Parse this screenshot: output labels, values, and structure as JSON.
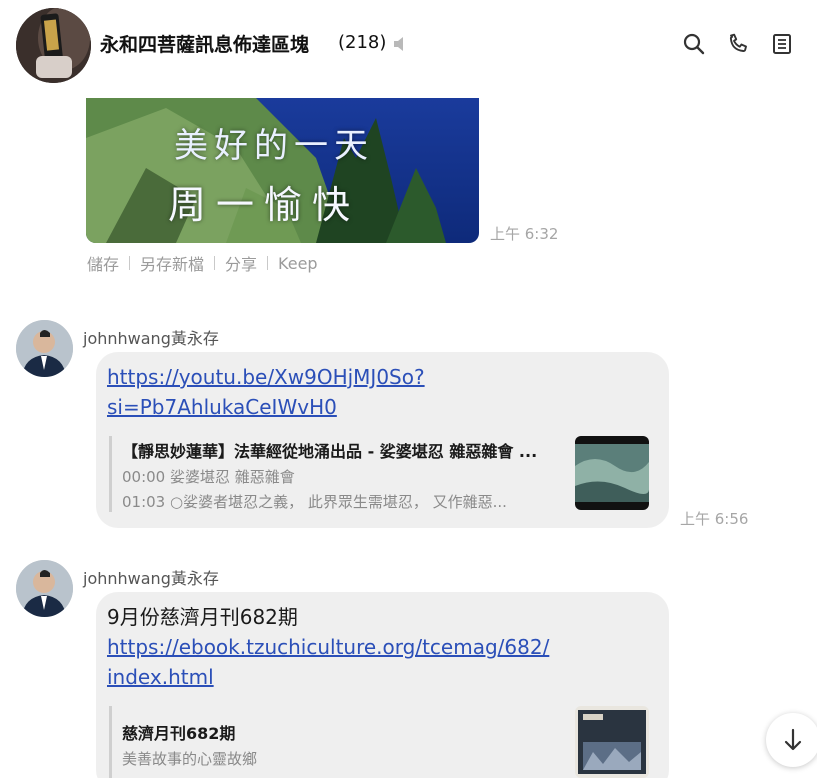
{
  "header": {
    "group_name": "永和四菩薩訊息佈達區塊",
    "member_count": "(218)",
    "icons": {
      "mute": "speaker-muted-icon",
      "search": "search-icon",
      "call": "phone-icon",
      "notes": "notes-icon"
    }
  },
  "image_message": {
    "caption_line1": "美好的一天",
    "caption_line2": "周一愉快",
    "time": "上午 6:32",
    "actions": [
      "儲存",
      "另存新檔",
      "分享",
      "Keep"
    ]
  },
  "messages": [
    {
      "sender": "johnhwang黃永存",
      "link_lines": [
        "https://youtu.be/Xw9OHjMJ0So?",
        "si=Pb7AhlukaCeIWvH0"
      ],
      "preview": {
        "title": "【靜思妙蓮華】法華經從地涌出品 - 娑婆堪忍 雜惡雜會 ...",
        "line1": "00:00 娑婆堪忍 雜惡雜會",
        "line2": "01:03 ○娑婆者堪忍之義， 此界眾生需堪忍， 又作雜惡..."
      },
      "time": "上午 6:56"
    },
    {
      "sender": "johnhwang黃永存",
      "text": "9月份慈濟月刊682期",
      "link_lines": [
        "https://ebook.tzuchiculture.org/tcemag/682/",
        "index.html"
      ],
      "preview": {
        "title": "慈濟月刊682期",
        "line1": "美善故事的心靈故鄉"
      }
    }
  ],
  "colors": {
    "bubble": "#efefef",
    "link": "#2b4fb8",
    "time": "#a6a6a6"
  }
}
